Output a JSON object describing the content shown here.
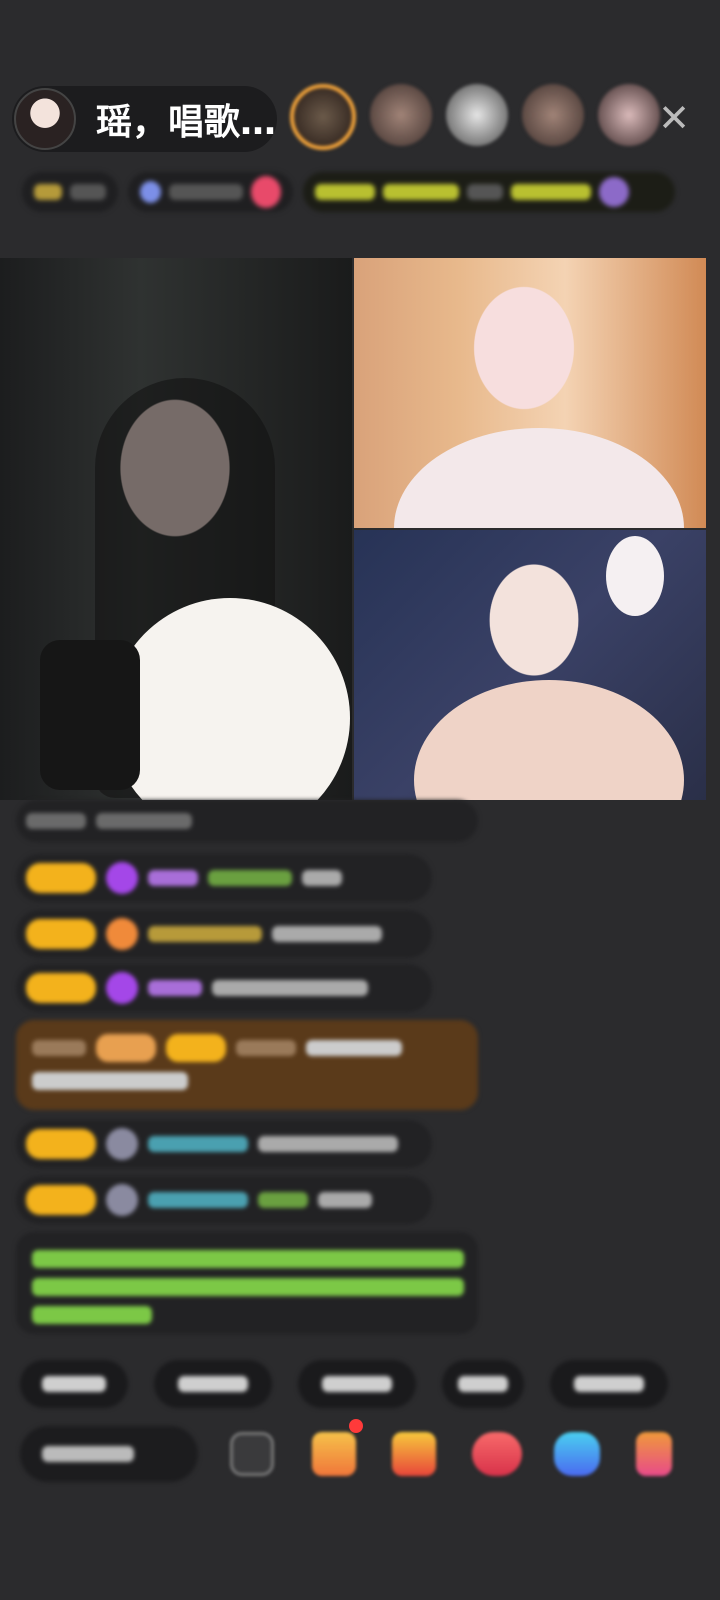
{
  "host": {
    "name": "瑶，唱歌…"
  },
  "header": {
    "close_glyph": "✕",
    "viewer_count": 5
  },
  "icons": {
    "host_avatar": "host-avatar",
    "close": "close-icon",
    "emoji": "emoji-icon",
    "gift": "gift-icon",
    "chest": "treasure-chest-icon",
    "heart": "heart-icon",
    "chat": "chat-icon",
    "pk": "pk-icon"
  },
  "colors": {
    "background": "#2b2b2d",
    "badge_yellow": "#f3b21c",
    "gem_purple": "#a447e8",
    "gift_orange": "#f08a3a",
    "system_green": "#7cc846",
    "highlight_brown": "#5a3a1a",
    "notification_red": "#ff3a3a"
  }
}
